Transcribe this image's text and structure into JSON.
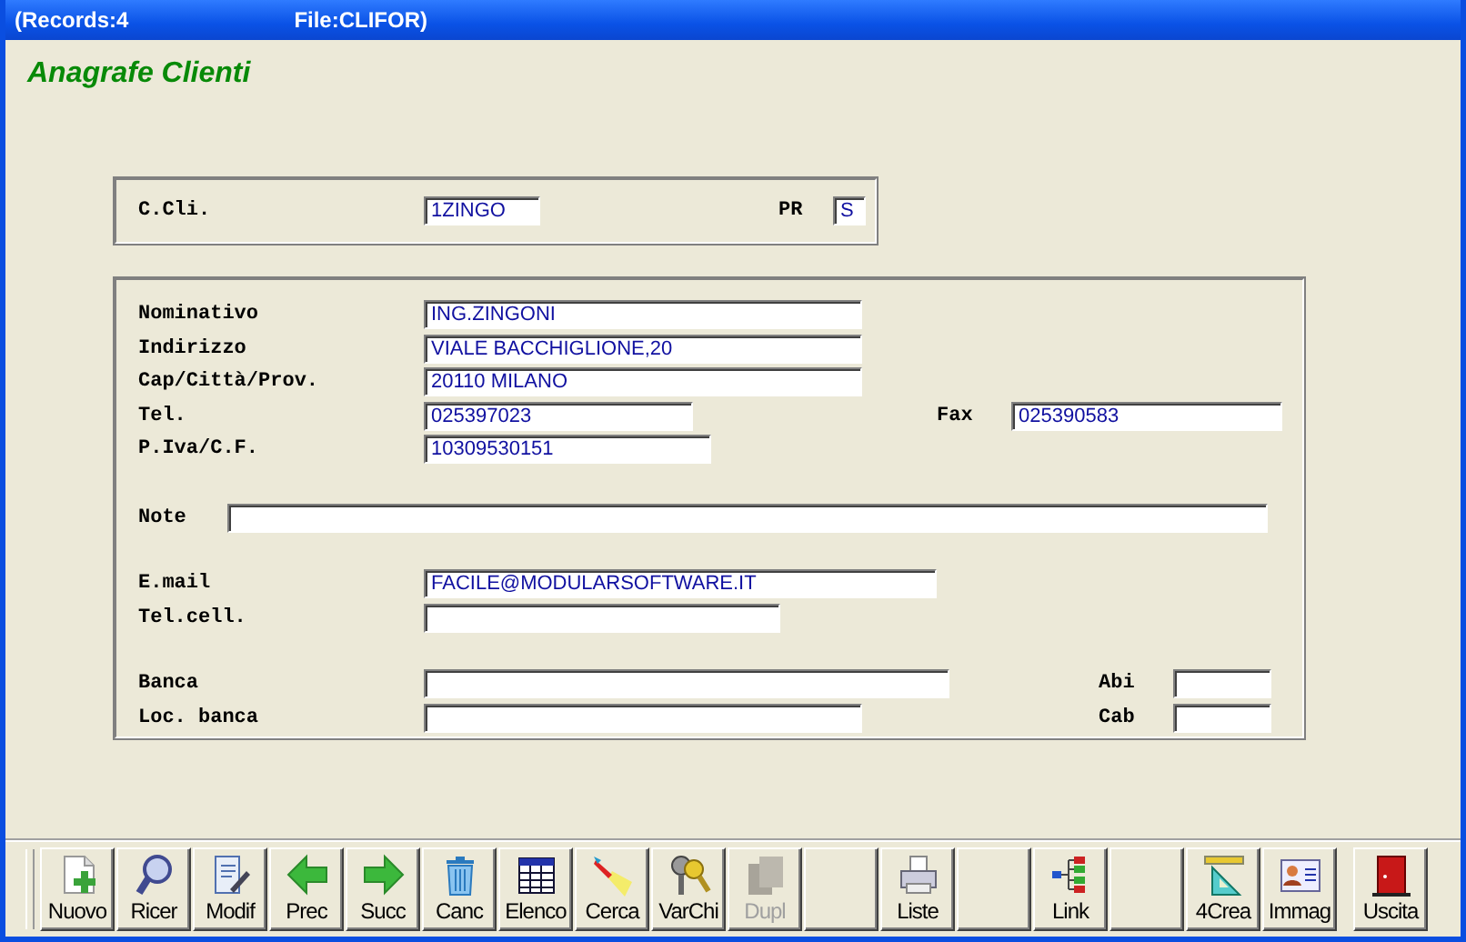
{
  "window": {
    "title_parts": [
      "(Records:4",
      "File:CLIFOR)"
    ]
  },
  "heading": "Anagrafe Clienti",
  "key_panel": {
    "fields": [
      {
        "label": "C.Cli.",
        "value": "1ZINGO"
      },
      {
        "label": "PR",
        "value": "S"
      }
    ]
  },
  "detail_panel": {
    "sections": [
      {
        "rows": [
          {
            "label": "Nominativo",
            "value": "ING.ZINGONI"
          },
          {
            "label": "Indirizzo",
            "value": "VIALE BACCHIGLIONE,20"
          },
          {
            "label": "Cap/Città/Prov.",
            "value": "20110 MILANO"
          },
          {
            "label": "Tel.",
            "value": "025397023",
            "side": {
              "label": "Fax",
              "value": "025390583"
            }
          },
          {
            "label": "P.Iva/C.F.",
            "value": "10309530151"
          }
        ]
      },
      {
        "rows": [
          {
            "label": "Note",
            "kind": "wide"
          }
        ]
      },
      {
        "rows": [
          {
            "label": "E.mail",
            "value": "FACILE@MODULARSOFTWARE.IT"
          },
          {
            "label": "Tel.cell."
          }
        ]
      },
      {
        "rows": [
          {
            "label": "Banca",
            "side": {
              "label": "Abi"
            }
          },
          {
            "label": "Loc. banca",
            "side": {
              "label": "Cab"
            }
          }
        ]
      }
    ]
  },
  "toolbar": [
    {
      "label": "Nuovo",
      "kind": "command",
      "disabled": false
    },
    {
      "label": "Ricer",
      "kind": "command",
      "disabled": false
    },
    {
      "label": "Modif",
      "kind": "command",
      "disabled": false
    },
    {
      "label": "Prec",
      "kind": "command",
      "disabled": false
    },
    {
      "label": "Succ",
      "kind": "command",
      "disabled": false
    },
    {
      "label": "Canc",
      "kind": "command",
      "disabled": false
    },
    {
      "label": "Elenco",
      "kind": "command",
      "disabled": false
    },
    {
      "label": "Cerca",
      "kind": "command",
      "disabled": false
    },
    {
      "label": "VarChi",
      "kind": "command",
      "disabled": false
    },
    {
      "label": "Dupl",
      "kind": "command",
      "disabled": true
    },
    {
      "kind": "blank"
    },
    {
      "label": "Liste",
      "kind": "command",
      "disabled": false
    },
    {
      "kind": "blank"
    },
    {
      "label": "Link",
      "kind": "command",
      "disabled": false
    },
    {
      "kind": "blank"
    },
    {
      "label": "4Crea",
      "kind": "command",
      "disabled": false
    },
    {
      "label": "Immag",
      "kind": "command",
      "disabled": false
    },
    {
      "label": "Uscita",
      "kind": "exit",
      "disabled": false
    }
  ]
}
